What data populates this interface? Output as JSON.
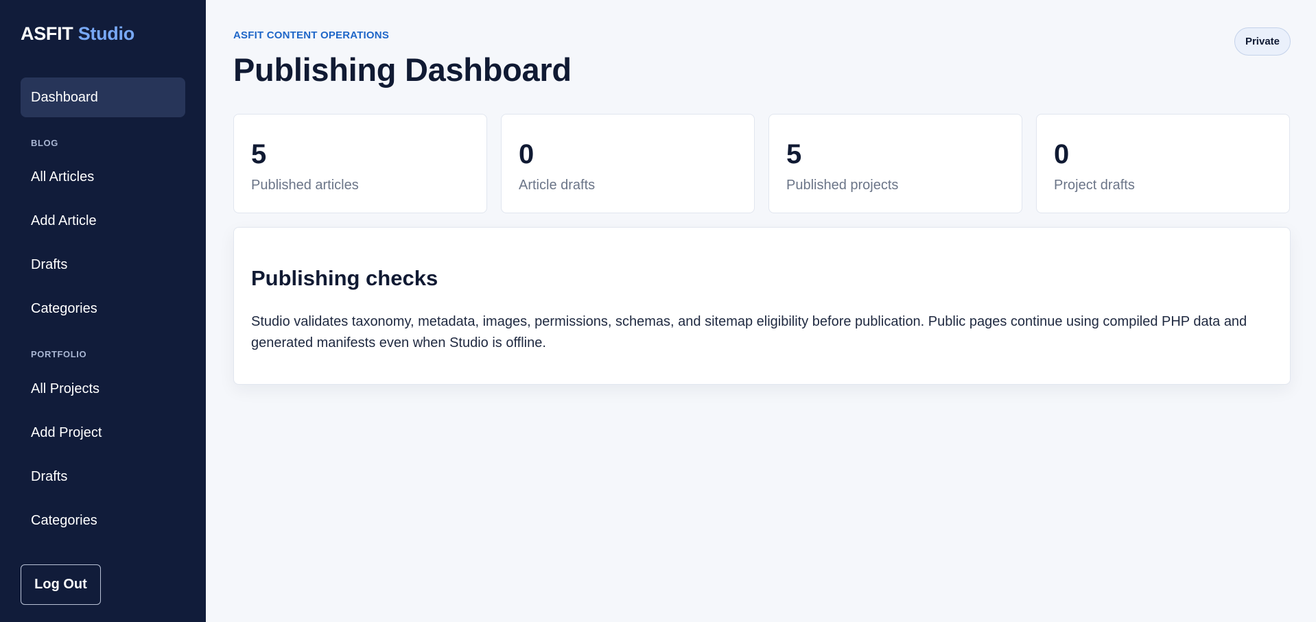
{
  "sidebar": {
    "brand_main": "ASFIT",
    "brand_accent": "Studio",
    "dashboard_label": "Dashboard",
    "blog_section": "BLOG",
    "blog_items": [
      "All Articles",
      "Add Article",
      "Drafts",
      "Categories"
    ],
    "portfolio_section": "PORTFOLIO",
    "portfolio_items": [
      "All Projects",
      "Add Project",
      "Drafts",
      "Categories"
    ],
    "logout_label": "Log Out"
  },
  "header": {
    "eyebrow": "ASFIT CONTENT OPERATIONS",
    "title": "Publishing Dashboard",
    "badge": "Private"
  },
  "stats": [
    {
      "value": "5",
      "label": "Published articles"
    },
    {
      "value": "0",
      "label": "Article drafts"
    },
    {
      "value": "5",
      "label": "Published projects"
    },
    {
      "value": "0",
      "label": "Project drafts"
    }
  ],
  "checks": {
    "title": "Publishing checks",
    "body": "Studio validates taxonomy, metadata, images, permissions, schemas, and sitemap eligibility before publication. Public pages continue using compiled PHP data and generated manifests even when Studio is offline."
  },
  "colors": {
    "sidebar_bg": "#111c3a",
    "brand_accent": "#78a8f5",
    "eyebrow": "#1e66c8",
    "page_bg": "#f5f7fb"
  }
}
